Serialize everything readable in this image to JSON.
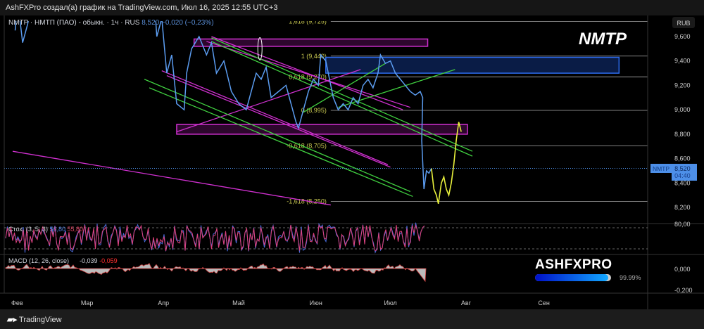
{
  "header": {
    "title": "AshFXPro создал(а) график на TradingView.com, Июл 16, 2025 12:55 UTC+3"
  },
  "legend": {
    "symbol": "NMTP · НМТП (ПАО) - обыкн. · 1ч · RUS",
    "price": "8,520",
    "change": "−0,020 (−0,23%)"
  },
  "ticker_label": "NMTP",
  "currency": "RUB",
  "current": {
    "symbol": "NMTP",
    "price": "8,520",
    "countdown": "04:40"
  },
  "stoch": {
    "label": "Стох. (3, 5, 3)",
    "k": "56,80",
    "d": "55,80",
    "level": "80,00"
  },
  "macd": {
    "label": "MACD (12, 26, close)",
    "v1": "-0,039",
    "v2": "-0,059",
    "ticks": [
      "0,000",
      "-0,200"
    ]
  },
  "brand": {
    "name": "ASHFXPRO",
    "progress_label": "99.99%",
    "progress": 0.9999
  },
  "footer": {
    "logo": "TradingView"
  },
  "colors": {
    "price": "#5b9cf0",
    "projection": "#e8f03c",
    "pink": "#d030d0",
    "green": "#40d040",
    "fib": "#c8c850"
  },
  "chart_data": {
    "type": "line",
    "x_unit": "days since Feb 1 2025",
    "x_ticks": [
      {
        "d": 0,
        "l": "Фев"
      },
      {
        "d": 28,
        "l": "Мар"
      },
      {
        "d": 59,
        "l": "Апр"
      },
      {
        "d": 89,
        "l": "Май"
      },
      {
        "d": 120,
        "l": "Июн"
      },
      {
        "d": 150,
        "l": "Июл"
      },
      {
        "d": 181,
        "l": "Авг"
      },
      {
        "d": 212,
        "l": "Сен"
      }
    ],
    "y_ticks": [
      9600,
      9400,
      9200,
      9000,
      8800,
      8600,
      8400,
      8200
    ],
    "y_tick_labels": [
      "9,600",
      "9,400",
      "9,200",
      "9,000",
      "8,800",
      "8,600",
      "8,400",
      "8,200"
    ],
    "ylim": [
      8150,
      9900
    ],
    "price": [
      [
        1,
        9650
      ],
      [
        2,
        9900
      ],
      [
        4,
        9550
      ],
      [
        6,
        9700
      ],
      [
        8,
        9900
      ],
      [
        57,
        9900
      ],
      [
        58,
        9600
      ],
      [
        60,
        9750
      ],
      [
        62,
        9300
      ],
      [
        64,
        9450
      ],
      [
        66,
        9050
      ],
      [
        69,
        9000
      ],
      [
        70,
        9300
      ],
      [
        72,
        9500
      ],
      [
        75,
        9600
      ],
      [
        78,
        9450
      ],
      [
        80,
        9550
      ],
      [
        82,
        9300
      ],
      [
        85,
        9400
      ],
      [
        88,
        9150
      ],
      [
        91,
        9050
      ],
      [
        94,
        9000
      ],
      [
        96,
        9150
      ],
      [
        98,
        9300
      ],
      [
        100,
        9250
      ],
      [
        102,
        9350
      ],
      [
        104,
        9100
      ],
      [
        107,
        9150
      ],
      [
        110,
        9200
      ],
      [
        112,
        9050
      ],
      [
        114,
        8900
      ],
      [
        115,
        8850
      ],
      [
        117,
        9000
      ],
      [
        119,
        9150
      ],
      [
        121,
        9250
      ],
      [
        123,
        9200
      ],
      [
        124,
        9450
      ],
      [
        126,
        9400
      ],
      [
        127,
        9300
      ],
      [
        129,
        9100
      ],
      [
        131,
        9000
      ],
      [
        133,
        9050
      ],
      [
        135,
        9000
      ],
      [
        137,
        9100
      ],
      [
        139,
        9050
      ],
      [
        141,
        9200
      ],
      [
        143,
        9250
      ],
      [
        145,
        9180
      ],
      [
        147,
        9300
      ],
      [
        148,
        9450
      ],
      [
        150,
        9380
      ],
      [
        152,
        9400
      ],
      [
        154,
        9300
      ],
      [
        156,
        9250
      ],
      [
        158,
        9200
      ],
      [
        160,
        9150
      ],
      [
        162,
        9120
      ],
      [
        164,
        9150
      ],
      [
        165,
        9100
      ],
      [
        164.6,
        8750
      ],
      [
        165.5,
        8350
      ],
      [
        166.5,
        8500
      ],
      [
        167.5,
        8480
      ],
      [
        168.5,
        8520
      ]
    ],
    "projection": [
      [
        168.5,
        8520
      ],
      [
        169.5,
        8350
      ],
      [
        170.5,
        8300
      ],
      [
        171.3,
        8230
      ],
      [
        172.5,
        8400
      ],
      [
        173.5,
        8450
      ],
      [
        174.5,
        8350
      ],
      [
        175.5,
        8300
      ],
      [
        176.5,
        8400
      ],
      [
        177.5,
        8550
      ],
      [
        178.5,
        8750
      ],
      [
        179.5,
        8900
      ],
      [
        180.5,
        8820
      ]
    ],
    "fib_levels": [
      {
        "v": 9725,
        "l": "1,618 (9,725)"
      },
      {
        "v": 9440,
        "l": "1 (9,440)"
      },
      {
        "v": 9270,
        "l": "0,618 (9,270)"
      },
      {
        "v": 8995,
        "l": "0 (8,995)"
      },
      {
        "v": 8705,
        "l": "-0,618 (8,705)"
      },
      {
        "v": 8250,
        "l": "-1,618 (8,250)"
      }
    ],
    "zones": [
      {
        "d1": 73,
        "d2": 167,
        "p1": 9580,
        "p2": 9520,
        "c": "pink"
      },
      {
        "d1": 126,
        "d2": 244,
        "p1": 9430,
        "p2": 9300,
        "c": "blue"
      },
      {
        "d1": 66,
        "d2": 183,
        "p1": 8880,
        "p2": 8800,
        "c": "pink"
      }
    ],
    "lines": [
      {
        "a": [
          78,
          9560
        ],
        "b": [
          160,
          9020
        ],
        "c": "pink"
      },
      {
        "a": [
          80,
          9600
        ],
        "b": [
          157,
          9000
        ],
        "c": "pink"
      },
      {
        "a": [
          60,
          9320
        ],
        "b": [
          151,
          8550
        ],
        "c": "pink"
      },
      {
        "a": [
          62,
          9280
        ],
        "b": [
          152,
          8530
        ],
        "c": "pink"
      },
      {
        "a": [
          66,
          8820
        ],
        "b": [
          140,
          9330
        ],
        "c": "pink"
      },
      {
        "a": [
          0,
          8660
        ],
        "b": [
          128,
          8220
        ],
        "c": "pink"
      },
      {
        "a": [
          80,
          9590
        ],
        "b": [
          185,
          8660
        ],
        "c": "green"
      },
      {
        "a": [
          80,
          9560
        ],
        "b": [
          185,
          8620
        ],
        "c": "green"
      },
      {
        "a": [
          53,
          9250
        ],
        "b": [
          160,
          8330
        ],
        "c": "green"
      },
      {
        "a": [
          55,
          9180
        ],
        "b": [
          161,
          8290
        ],
        "c": "green"
      },
      {
        "a": [
          117,
          8980
        ],
        "b": [
          150,
          9380
        ],
        "c": "green"
      },
      {
        "a": [
          131,
          9020
        ],
        "b": [
          178,
          9330
        ],
        "c": "green"
      }
    ]
  }
}
